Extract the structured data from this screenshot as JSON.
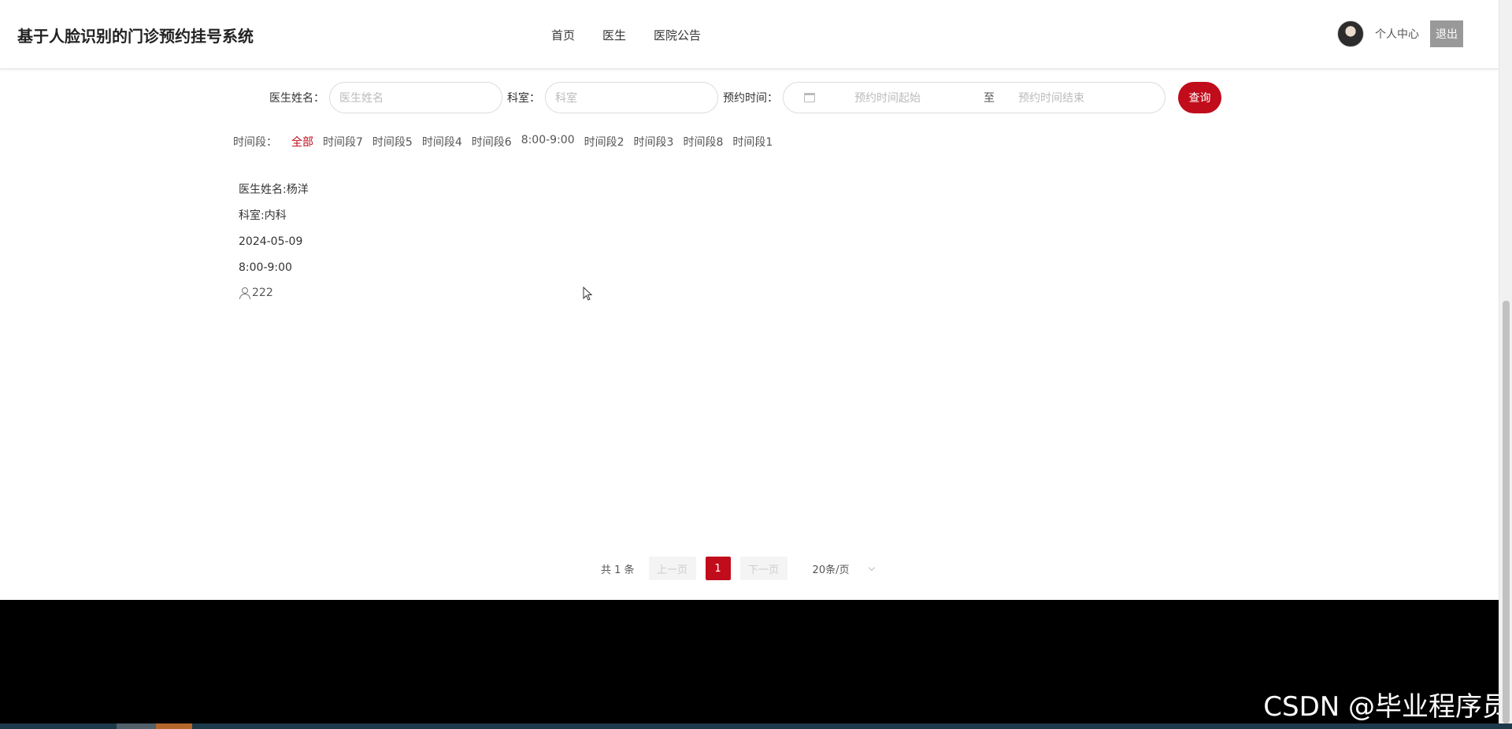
{
  "header": {
    "title": "基于人脸识别的门诊预约挂号系统",
    "nav": [
      "首页",
      "医生",
      "医院公告"
    ],
    "user_center": "个人中心",
    "logout": "退出"
  },
  "search": {
    "doctor_label": "医生姓名：",
    "doctor_placeholder": "医生姓名",
    "dept_label": "科室：",
    "dept_placeholder": "科室",
    "time_label": "预约时间：",
    "start_placeholder": "预约时间起始",
    "separator": "至",
    "end_placeholder": "预约时间结束",
    "query_button": "查询"
  },
  "time_filter": {
    "label": "时间段：",
    "options": [
      "全部",
      "时间段7",
      "时间段5",
      "时间段4",
      "时间段6",
      "8:00-9:00",
      "时间段2",
      "时间段3",
      "时间段8",
      "时间段1"
    ],
    "active": "全部"
  },
  "result": {
    "doctor": "医生姓名:杨洋",
    "dept": "科室:内科",
    "date": "2024-05-09",
    "time": "8:00-9:00",
    "count": "222"
  },
  "pagination": {
    "total": "共 1 条",
    "prev": "上一页",
    "current": "1",
    "next": "下一页",
    "page_size": "20条/页"
  },
  "watermark": "CSDN @毕业程序员",
  "colors": {
    "accent": "#c00c1b",
    "footer": "#000000"
  }
}
